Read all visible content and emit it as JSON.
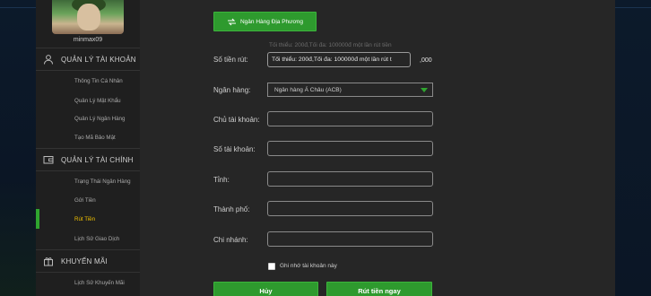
{
  "sidebar": {
    "username": "minmax09",
    "sections": [
      {
        "label": "QUẢN LÝ TÀI KHOẢN",
        "icon": "user-icon"
      },
      {
        "label": "QUẢN LÝ TÀI CHÍNH",
        "icon": "wallet-icon"
      },
      {
        "label": "KHUYẾN MÃI",
        "icon": "gift-icon"
      }
    ],
    "account_items": [
      "Thông Tin Cá Nhân",
      "Quản Lý Mật Khẩu",
      "Quản Lý Ngân Hàng",
      "Tạo Mã Bảo Mật"
    ],
    "finance_items": [
      "Trạng Thái Ngân Hàng",
      "Gửi Tiền",
      "Rút Tiền",
      "Lịch Sử Giao Dịch"
    ],
    "promo_items": [
      "Lịch Sử Khuyến Mãi"
    ],
    "active_item": "Rút Tiền"
  },
  "form": {
    "local_bank_button": "Ngân Hàng Địa Phương",
    "amount_hint": "Tối thiểu: 200đ,Tối đa: 100000đ một lần rút tiền",
    "amount_label": "Số tiền rút:",
    "amount_placeholder": "Tối thiểu: 200đ,Tối đa: 100000đ một lần rút t",
    "amount_suffix": ",000",
    "bank_label": "Ngân hàng:",
    "bank_selected": "Ngân hàng Á Châu (ACB)",
    "account_holder_label": "Chủ tài khoản:",
    "account_number_label": "Số tài khoản:",
    "province_label": "Tỉnh:",
    "city_label": "Thành phố:",
    "branch_label": "Chi nhánh:",
    "remember_label": "Ghi nhớ tài khoản này",
    "cancel_button": "Hủy",
    "submit_button": "Rút tiền ngay"
  },
  "colors": {
    "accent_green": "#2e9a2e",
    "active_yellow": "#f0c000",
    "panel": "#262626"
  }
}
